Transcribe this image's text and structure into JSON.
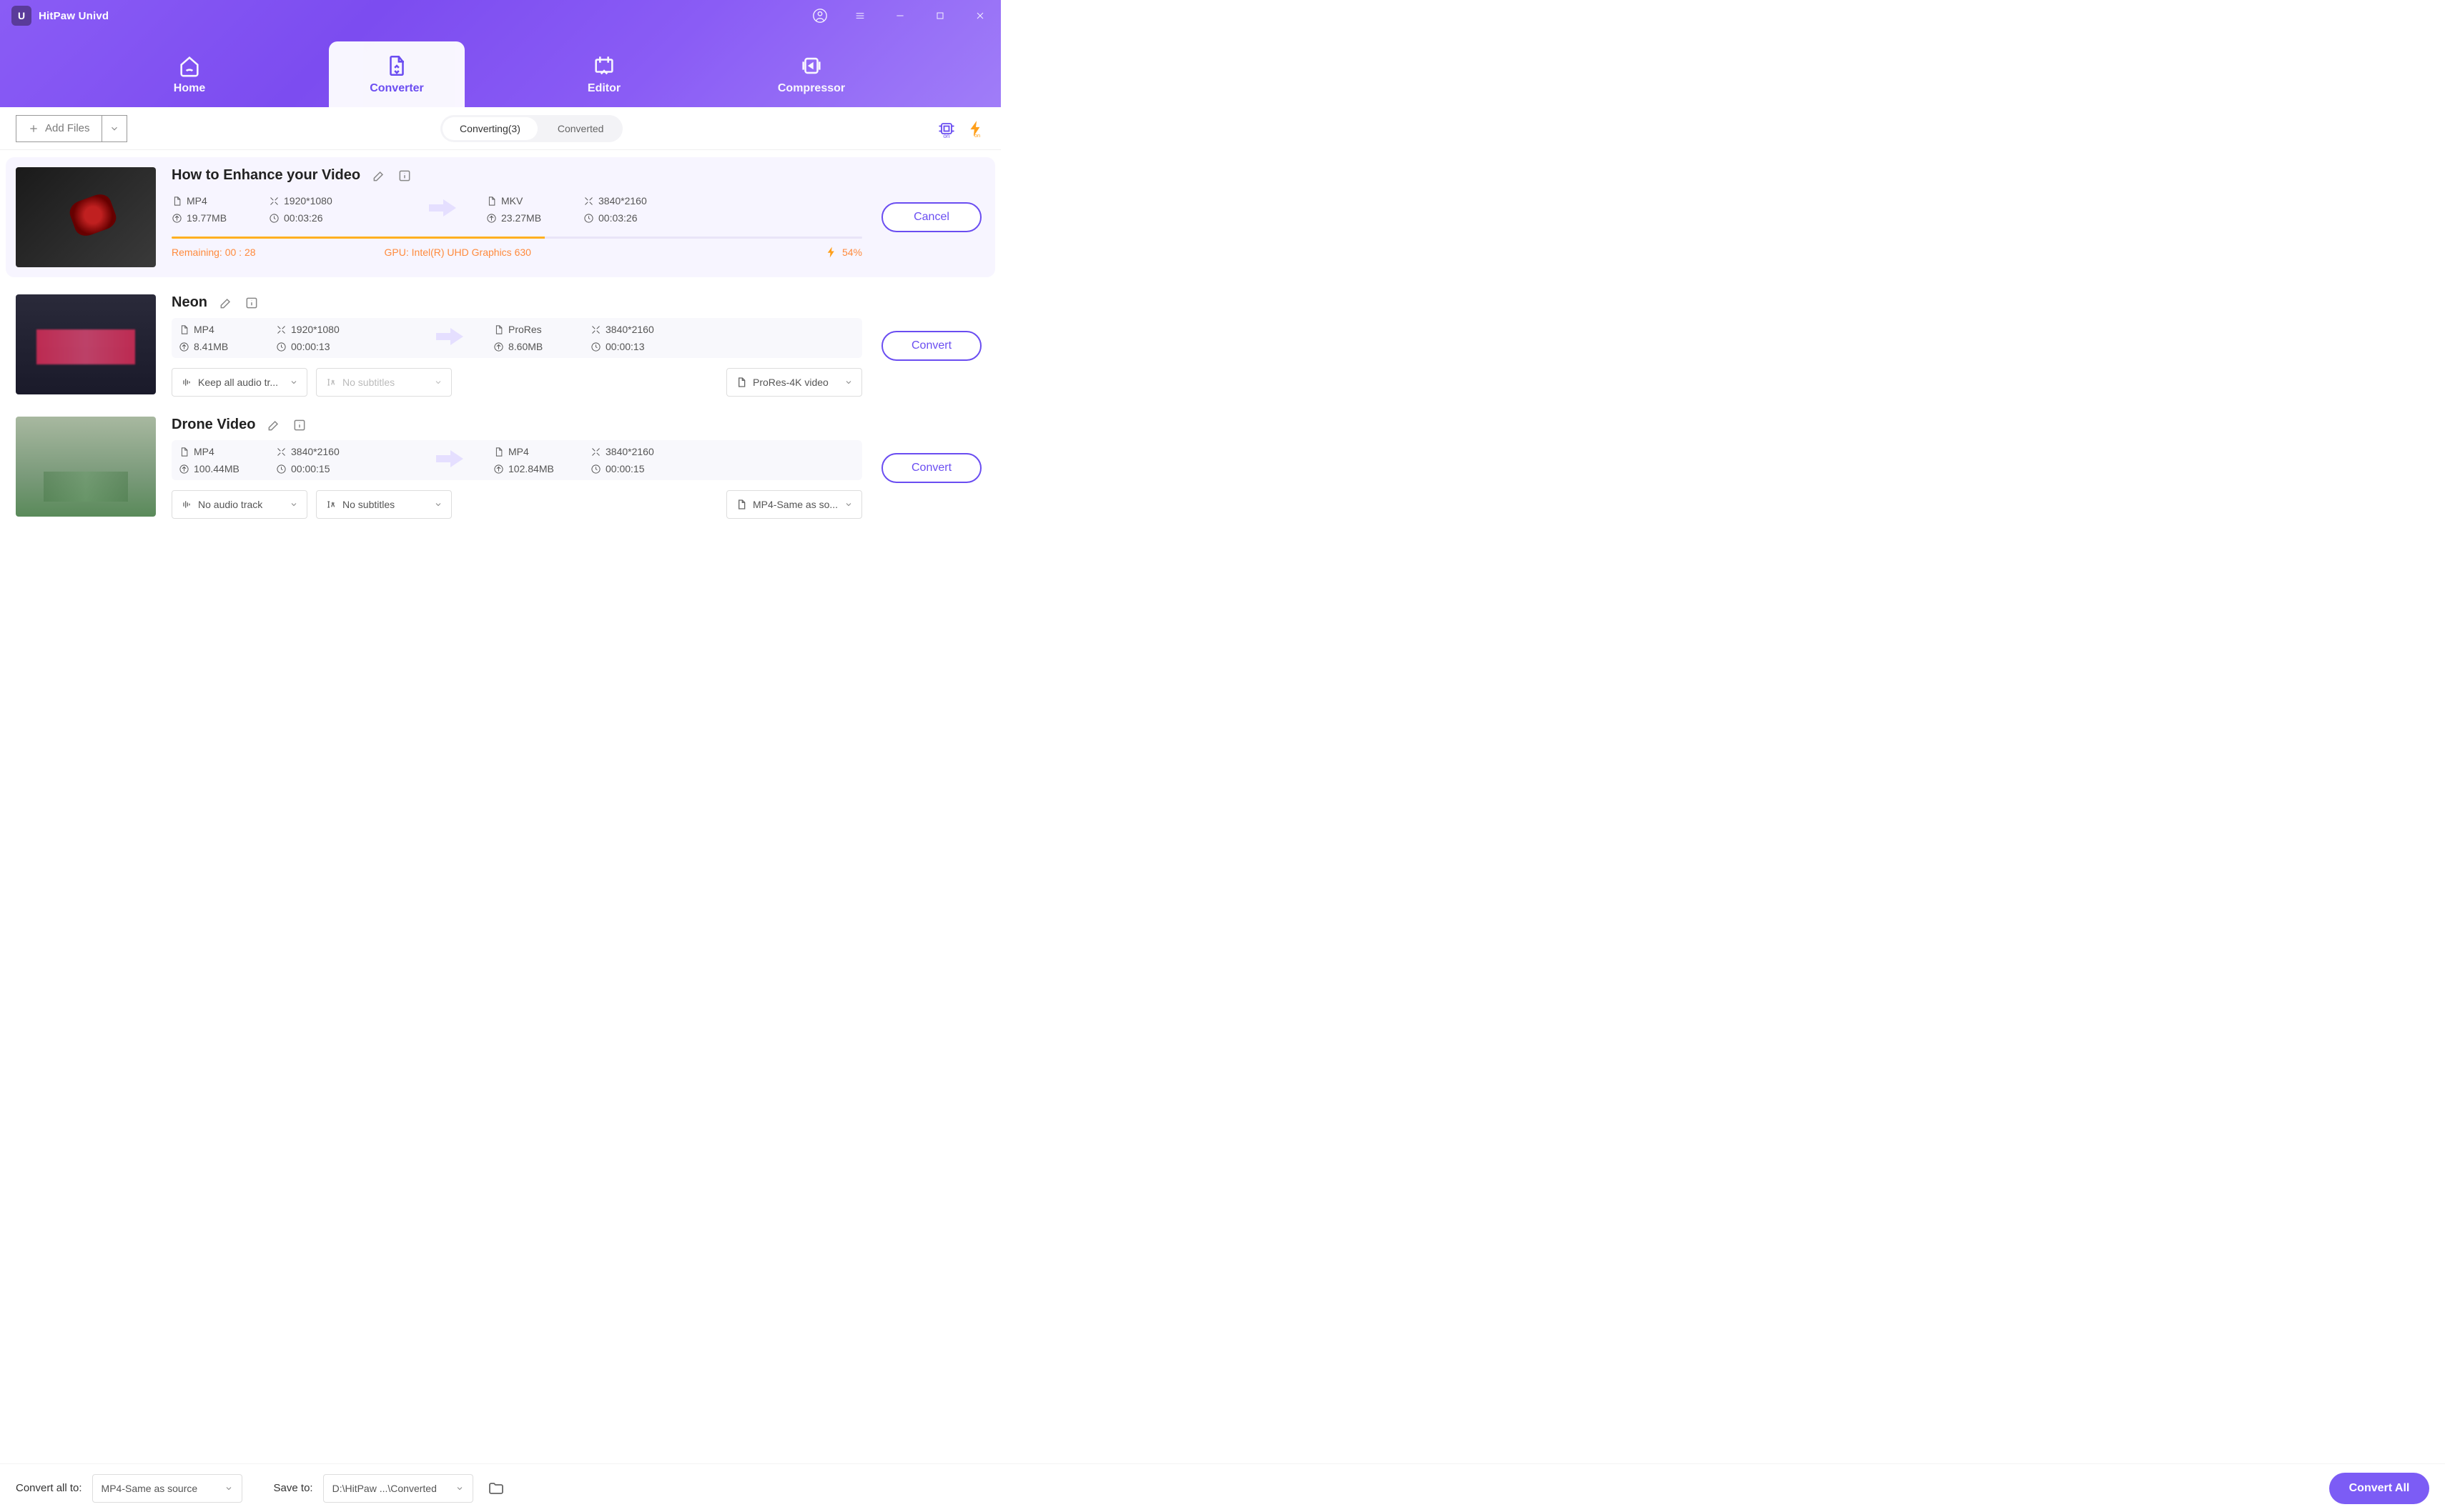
{
  "app": {
    "title": "HitPaw Univd"
  },
  "nav": {
    "home": "Home",
    "converter": "Converter",
    "editor": "Editor",
    "compressor": "Compressor"
  },
  "toolbar": {
    "add_files": "Add Files",
    "sub_converting": "Converting(3)",
    "sub_converted": "Converted"
  },
  "items": [
    {
      "title": "How to Enhance your Video",
      "src": {
        "format": "MP4",
        "res": "1920*1080",
        "size": "19.77MB",
        "dur": "00:03:26"
      },
      "dst": {
        "format": "MKV",
        "res": "3840*2160",
        "size": "23.27MB",
        "dur": "00:03:26"
      },
      "progress": {
        "remaining_label": "Remaining: 00 : 28",
        "gpu": "GPU: Intel(R) UHD Graphics 630",
        "pct": "54%",
        "fill": 54
      },
      "action": "Cancel"
    },
    {
      "title": "Neon",
      "src": {
        "format": "MP4",
        "res": "1920*1080",
        "size": "8.41MB",
        "dur": "00:00:13"
      },
      "dst": {
        "format": "ProRes",
        "res": "3840*2160",
        "size": "8.60MB",
        "dur": "00:00:13"
      },
      "dd": {
        "audio": "Keep all audio tr...",
        "subtitle": "No subtitles",
        "out": "ProRes-4K video"
      },
      "action": "Convert"
    },
    {
      "title": "Drone Video",
      "src": {
        "format": "MP4",
        "res": "3840*2160",
        "size": "100.44MB",
        "dur": "00:00:15"
      },
      "dst": {
        "format": "MP4",
        "res": "3840*2160",
        "size": "102.84MB",
        "dur": "00:00:15"
      },
      "dd": {
        "audio": "No audio track",
        "subtitle": "No subtitles",
        "out": "MP4-Same as so..."
      },
      "action": "Convert"
    }
  ],
  "footer": {
    "convert_all_to": "Convert all to:",
    "convert_all_dd": "MP4-Same as source",
    "save_to": "Save to:",
    "save_to_dd": "D:\\HitPaw ...\\Converted",
    "convert_all_btn": "Convert All"
  }
}
